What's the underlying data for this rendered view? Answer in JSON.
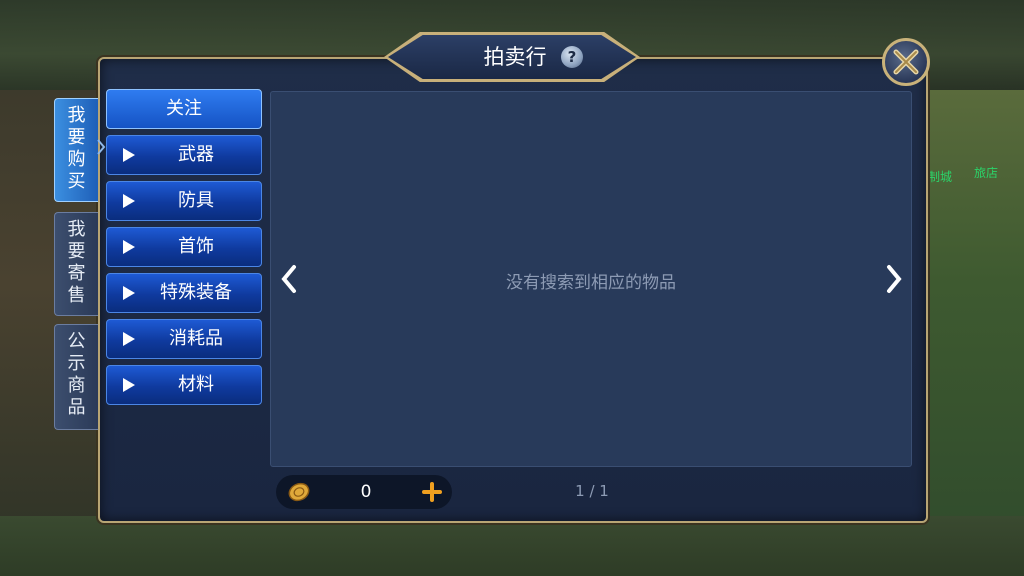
{
  "window": {
    "title": "拍卖行",
    "help_icon": "question-icon",
    "close_icon": "close-x-icon"
  },
  "side_tabs": [
    {
      "label": "我要购买",
      "active": true
    },
    {
      "label": "我要寄售",
      "active": false
    },
    {
      "label": "公示商品",
      "active": false
    }
  ],
  "categories": [
    {
      "label": "关注",
      "selected": true
    },
    {
      "label": "武器",
      "selected": false
    },
    {
      "label": "防具",
      "selected": false
    },
    {
      "label": "首饰",
      "selected": false
    },
    {
      "label": "特殊装备",
      "selected": false
    },
    {
      "label": "消耗品",
      "selected": false
    },
    {
      "label": "材料",
      "selected": false
    }
  ],
  "content": {
    "empty_message": "没有搜索到相应的物品",
    "prev_icon": "chevron-left-icon",
    "next_icon": "chevron-right-icon"
  },
  "currency": {
    "icon": "gold-coin-icon",
    "value": "0",
    "add_icon": "plus-icon"
  },
  "pagination": {
    "text": "1 / 1"
  },
  "background_signs": {
    "sign1": "制城",
    "sign2": "旅店"
  },
  "colors": {
    "accent_blue": "#1e5ad4",
    "gold_border": "#c9b27a",
    "panel_bg": "#1f2d48",
    "plus_orange": "#f0a020"
  }
}
